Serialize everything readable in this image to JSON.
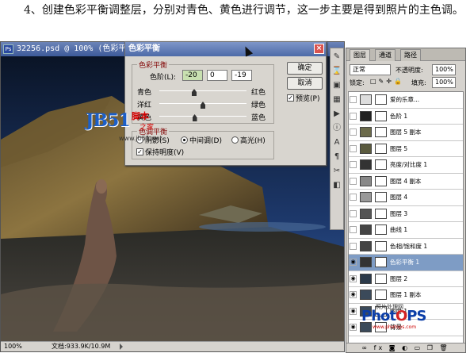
{
  "caption": "4、创建色彩平衡调整层，分别对青色、黄色进行调节，这一步主要是得到照片的主色调。",
  "document": {
    "title": "32256.psd @ 100% (色彩平衡 1, 图层蒙版/8)",
    "zoom": "100%",
    "doc_size": "文档:933.9K/10.9M"
  },
  "dialog": {
    "title": "色彩平衡",
    "group_label": "色彩平衡",
    "levels_label": "色阶(L):",
    "levels": [
      "-20",
      "0",
      "-19"
    ],
    "slider1_left": "青色",
    "slider1_right": "红色",
    "slider2_left": "洋红",
    "slider2_right": "绿色",
    "slider3_left": "黄色",
    "slider3_right": "蓝色",
    "slider_levels": [
      -20,
      0,
      -19
    ],
    "tone_group": "色调平衡",
    "shadows": "阴影(S)",
    "midtones": "中间调(D)",
    "highlights": "高光(H)",
    "preserve_luminosity": "保持明度(V)",
    "ok": "确定",
    "cancel": "取消",
    "preview": "预览(P)"
  },
  "layers_panel": {
    "tabs": [
      "图层",
      "通道",
      "路径"
    ],
    "blend_mode": "正常",
    "opacity_label": "不透明度:",
    "opacity": "100%",
    "lock_label": "锁定:",
    "fill_label": "填充:",
    "fill": "100%",
    "layers": [
      {
        "name": "爱的乐章...",
        "visible": false,
        "selected": false,
        "color": "#dddddd"
      },
      {
        "name": "色阶 1",
        "visible": false,
        "selected": false,
        "color": "#222222"
      },
      {
        "name": "图层 5 副本",
        "visible": false,
        "selected": false,
        "color": "#6b6a4a"
      },
      {
        "name": "图层 5",
        "visible": false,
        "selected": false,
        "color": "#5a5a3e"
      },
      {
        "name": "亮度/对比度 1",
        "visible": false,
        "selected": false,
        "color": "#333333"
      },
      {
        "name": "图层 4 副本",
        "visible": false,
        "selected": false,
        "color": "#888888"
      },
      {
        "name": "图层 4",
        "visible": false,
        "selected": false,
        "color": "#999999"
      },
      {
        "name": "图层 3",
        "visible": false,
        "selected": false,
        "color": "#555555"
      },
      {
        "name": "曲线 1",
        "visible": false,
        "selected": false,
        "color": "#444444"
      },
      {
        "name": "色相/饱和度 1",
        "visible": false,
        "selected": false,
        "color": "#444444"
      },
      {
        "name": "色彩平衡 1",
        "visible": true,
        "selected": true,
        "color": "#333333"
      },
      {
        "name": "图层 2",
        "visible": true,
        "selected": false,
        "color": "#2c3a4a"
      },
      {
        "name": "图层 1 副本",
        "visible": true,
        "selected": false,
        "color": "#3b4a5a"
      },
      {
        "name": "图层 1",
        "visible": true,
        "selected": false,
        "color": "#3b4a5a"
      },
      {
        "name": "背景",
        "visible": true,
        "selected": false,
        "color": "#3b4a5a"
      }
    ]
  },
  "watermark": {
    "jb51": "JB51",
    "jb51_cn": "脚本",
    "jb51_sub": "之家",
    "jb51_url": "www.jb51.net",
    "photops_small": "照片处理网",
    "photops": [
      "Phot",
      "PS"
    ],
    "photops_url": "www.photops.com"
  }
}
